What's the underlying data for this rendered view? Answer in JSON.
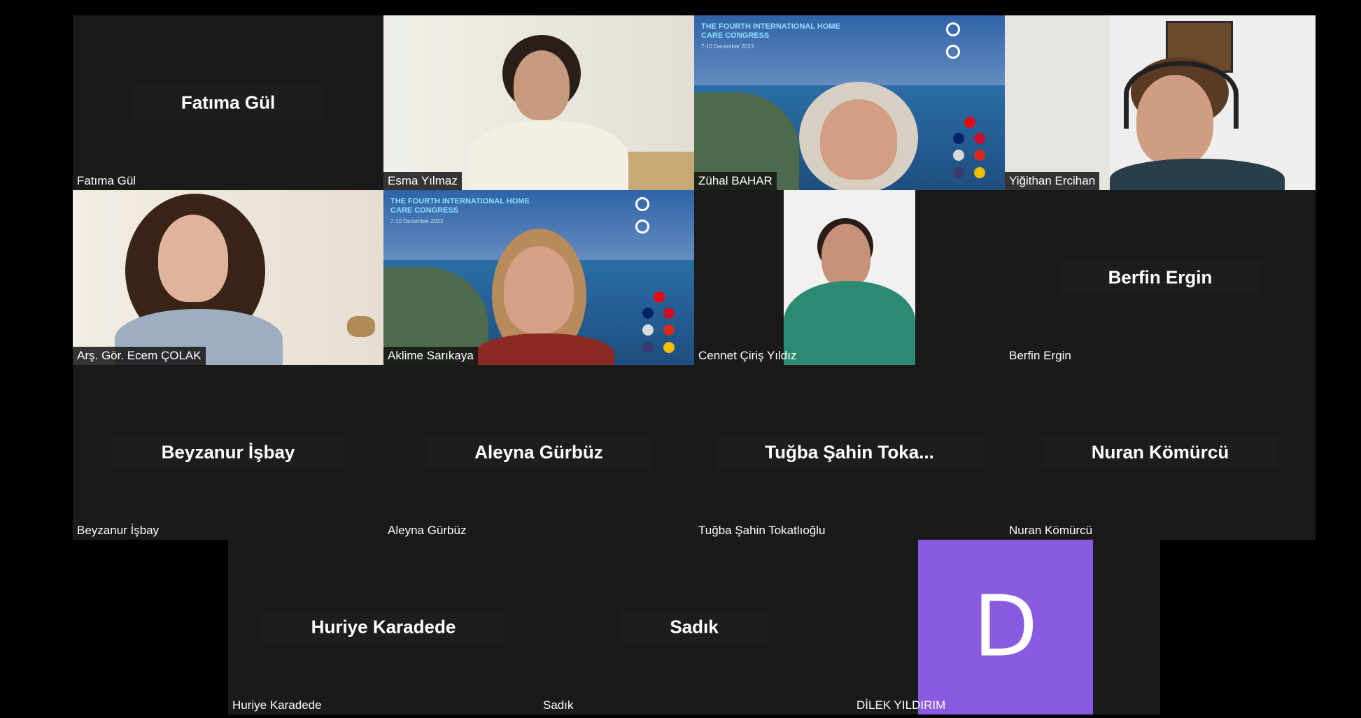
{
  "participants": {
    "fatima": {
      "display_name": "Fatıma Gül",
      "label": "Fatıma Gül"
    },
    "esma": {
      "label": "Esma Yılmaz"
    },
    "zuhal": {
      "label": "Zühal BAHAR",
      "banner_title": "THE FOURTH INTERNATIONAL HOME CARE CONGRESS",
      "banner_date": "7-10 December 2023"
    },
    "yigithan": {
      "label": "Yiğithan Ercihan"
    },
    "ecem": {
      "label": "Arş. Gör. Ecem ÇOLAK"
    },
    "aklime": {
      "label": "Aklime Sarıkaya",
      "banner_title": "THE FOURTH INTERNATIONAL HOME CARE CONGRESS",
      "banner_date": "7-10 December 2023"
    },
    "cennet": {
      "label": "Cennet Çiriş Yıldız"
    },
    "berfin": {
      "display_name": "Berfin Ergin",
      "label": "Berfin Ergin"
    },
    "beyzanur": {
      "display_name": "Beyzanur İşbay",
      "label": "Beyzanur İşbay"
    },
    "aleyna": {
      "display_name": "Aleyna Gürbüz",
      "label": "Aleyna Gürbüz"
    },
    "tugba": {
      "display_name": "Tuğba Şahin Toka...",
      "label": "Tuğba Şahin Tokatlıoğlu"
    },
    "nuran": {
      "display_name": "Nuran Kömürcü",
      "label": "Nuran Kömürcü"
    },
    "huriye": {
      "display_name": "Huriye Karadede",
      "label": "Huriye Karadede"
    },
    "sadik": {
      "display_name": "Sadık",
      "label": "Sadık"
    },
    "dilek": {
      "avatar_letter": "D",
      "label": "DİLEK YILDIRIM",
      "avatar_color": "#8a5be0"
    }
  }
}
